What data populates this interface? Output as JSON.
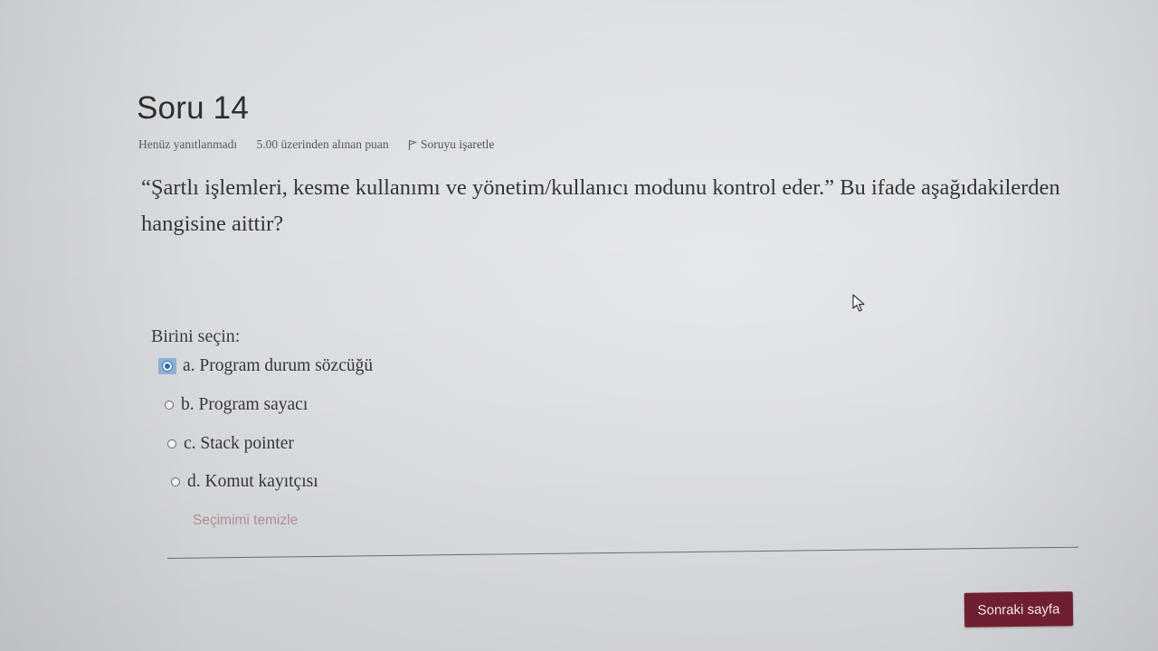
{
  "question": {
    "title": "Soru 14",
    "status": "Henüz yanıtlanmadı",
    "points": "5.00 üzerinden alınan puan",
    "flag_label": "Soruyu işaretle",
    "text": "“Şartlı işlemleri, kesme kullanımı ve yönetim/kullanıcı modunu kontrol eder.” Bu ifade aşağıdakilerden hangisine aittir?"
  },
  "answers": {
    "prompt": "Birini seçin:",
    "options": [
      {
        "label": "a. Program durum sözcüğü",
        "selected": true
      },
      {
        "label": "b. Program sayacı",
        "selected": false
      },
      {
        "label": "c. Stack pointer",
        "selected": false
      },
      {
        "label": "d. Komut kayıtçısı",
        "selected": false
      }
    ],
    "clear_label": "Seçimimi temizle"
  },
  "navigation": {
    "next_label": "Sonraki sayfa"
  },
  "icons": {
    "flag": "flag-icon",
    "cursor": "mouse-pointer-icon",
    "radio": "radio-icon"
  },
  "colors": {
    "next_button_bg": "#6f1f2f",
    "clear_link": "#b58a95",
    "selected_radio": "#2f67b5"
  }
}
